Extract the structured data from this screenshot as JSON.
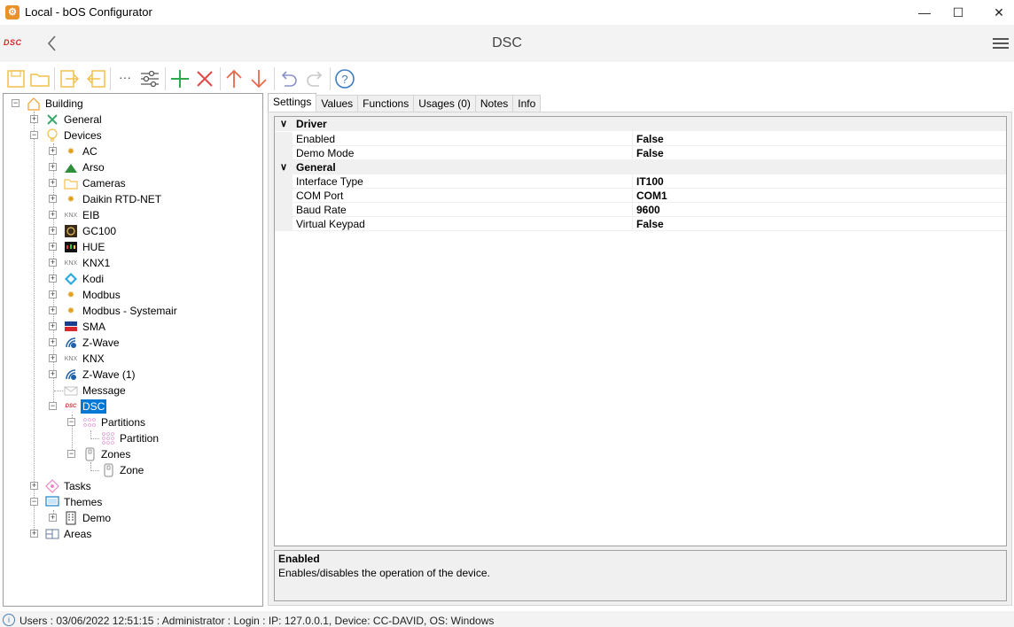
{
  "window": {
    "title": "Local - bOS Configurator",
    "minimize": "—",
    "maximize": "☐",
    "close": "✕"
  },
  "header": {
    "logo_text": "DSC",
    "title": "DSC"
  },
  "toolbar": {
    "buttons": [
      "save",
      "open",
      "import",
      "export",
      "more",
      "settings",
      "add",
      "delete",
      "move-up",
      "move-down",
      "undo",
      "redo",
      "help"
    ],
    "more_label": "···",
    "help_label": "?"
  },
  "tree": {
    "building": "Building",
    "general": "General",
    "devices": "Devices",
    "device_items": [
      "AC",
      "Arso",
      "Cameras",
      "Daikin RTD-NET",
      "EIB",
      "GC100",
      "HUE",
      "KNX1",
      "Kodi",
      "Modbus",
      "Modbus - Systemair",
      "SMA",
      "Z-Wave",
      "KNX",
      "Z-Wave (1)",
      "Message"
    ],
    "dsc": "DSC",
    "partitions": "Partitions",
    "partition": "Partition",
    "zones": "Zones",
    "zone": "Zone",
    "tasks": "Tasks",
    "themes": "Themes",
    "demo": "Demo",
    "areas": "Areas"
  },
  "tabs": [
    "Settings",
    "Values",
    "Functions",
    "Usages (0)",
    "Notes",
    "Info"
  ],
  "properties": {
    "driver_label": "Driver",
    "enabled_label": "Enabled",
    "enabled_value": "False",
    "demo_label": "Demo Mode",
    "demo_value": "False",
    "general_label": "General",
    "interface_label": "Interface Type",
    "interface_value": "IT100",
    "com_label": "COM Port",
    "com_value": "COM1",
    "baud_label": "Baud Rate",
    "baud_value": "9600",
    "keypad_label": "Virtual Keypad",
    "keypad_value": "False"
  },
  "description": {
    "title": "Enabled",
    "text": "Enables/disables the operation of the device."
  },
  "status": {
    "text": "Users : 03/06/2022 12:51:15 : Administrator : Login : IP: 127.0.0.1, Device: CC-DAVID, OS: Windows"
  }
}
